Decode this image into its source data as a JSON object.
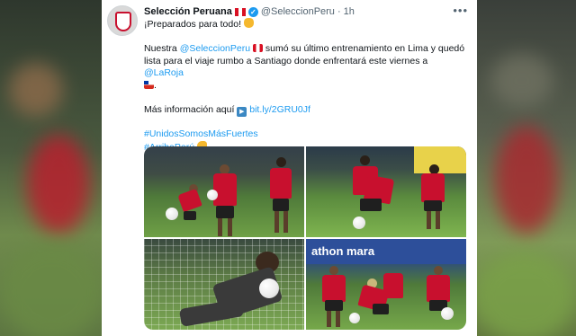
{
  "tweet": {
    "display_name": "Selección Peruana",
    "handle": "@SeleccionPeru",
    "dot": "·",
    "time": "1h",
    "more_label": "•••",
    "line1": "¡Preparados para todo!",
    "p2_prefix": "Nuestra ",
    "p2_mention": "@SeleccionPeru",
    "p2_mid": " sumó su último entrenamiento en Lima y quedó lista para el viaje rumbo a Santiago donde enfrentará este viernes a ",
    "p2_mention2": "@LaRoja",
    "p2_end": ".",
    "info_prefix": "Más información aquí ",
    "info_link": "bit.ly/2GRU0Jf",
    "hashtag1": "#UnidosSomosMásFuertes",
    "hashtag2": "#ArribaPerú",
    "verified_mark": "✓"
  },
  "icons": {
    "fist": "oncoming-fist-emoji",
    "peru_flag": "peru-flag-emoji",
    "chile_flag": "chile-flag-emoji",
    "play": "play-button-emoji",
    "muscle": "flexed-biceps-emoji"
  },
  "photos": {
    "banner_text": "athon mara"
  },
  "colors": {
    "link": "#1d9bf0",
    "jersey": "#c8102e",
    "text": "#0f1419",
    "muted": "#536471"
  }
}
